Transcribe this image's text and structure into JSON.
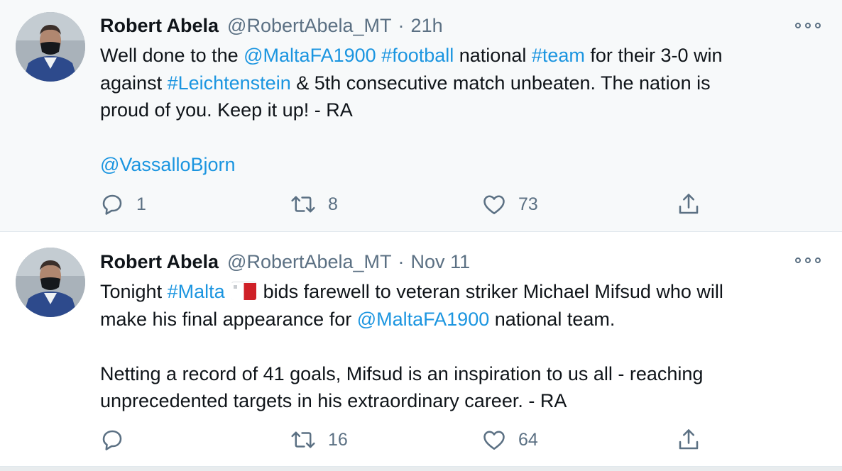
{
  "tweets": [
    {
      "name": "Robert Abela",
      "handle": "@RobertAbela_MT",
      "separator": "·",
      "time": "21h",
      "body": {
        "l1_a": "Well done to the ",
        "l1_link1": "@MaltaFA1900",
        "l1_b": " ",
        "l1_link2": "#football",
        "l1_c": " national ",
        "l1_link3": "#team",
        "l1_d": " for their 3-0 win",
        "l2_a": "against ",
        "l2_link1": "#Leichtenstein",
        "l2_b": " & 5th consecutive match unbeaten. The nation is",
        "l3": "proud of you. Keep it up! - RA",
        "l5_link": "@VassalloBjorn"
      },
      "counts": {
        "reply": "1",
        "retweet": "8",
        "like": "73"
      }
    },
    {
      "name": "Robert Abela",
      "handle": "@RobertAbela_MT",
      "separator": "·",
      "time": "Nov 11",
      "body": {
        "l1_a": "Tonight ",
        "l1_link1": "#Malta",
        "l1_b": " bids farewell to veteran striker Michael Mifsud who will",
        "l2_a": "make his final appearance for ",
        "l2_link1": "@MaltaFA1900",
        "l2_b": " national team.",
        "l4": "Netting a record of 41 goals, Mifsud is an inspiration to us all - reaching",
        "l5": "unprecedented targets in his extraordinary career. - RA"
      },
      "counts": {
        "reply": "",
        "retweet": "16",
        "like": "64"
      }
    }
  ],
  "icons": {
    "more": "more-icon",
    "reply": "reply-icon",
    "retweet": "retweet-icon",
    "like": "like-icon",
    "share": "share-icon",
    "flag": "malta-flag-icon"
  },
  "colors": {
    "link": "#1b95e0",
    "secondary_text": "#5b7083",
    "highlight_bg": "#f7f9fa",
    "divider": "#e1e8ed"
  }
}
